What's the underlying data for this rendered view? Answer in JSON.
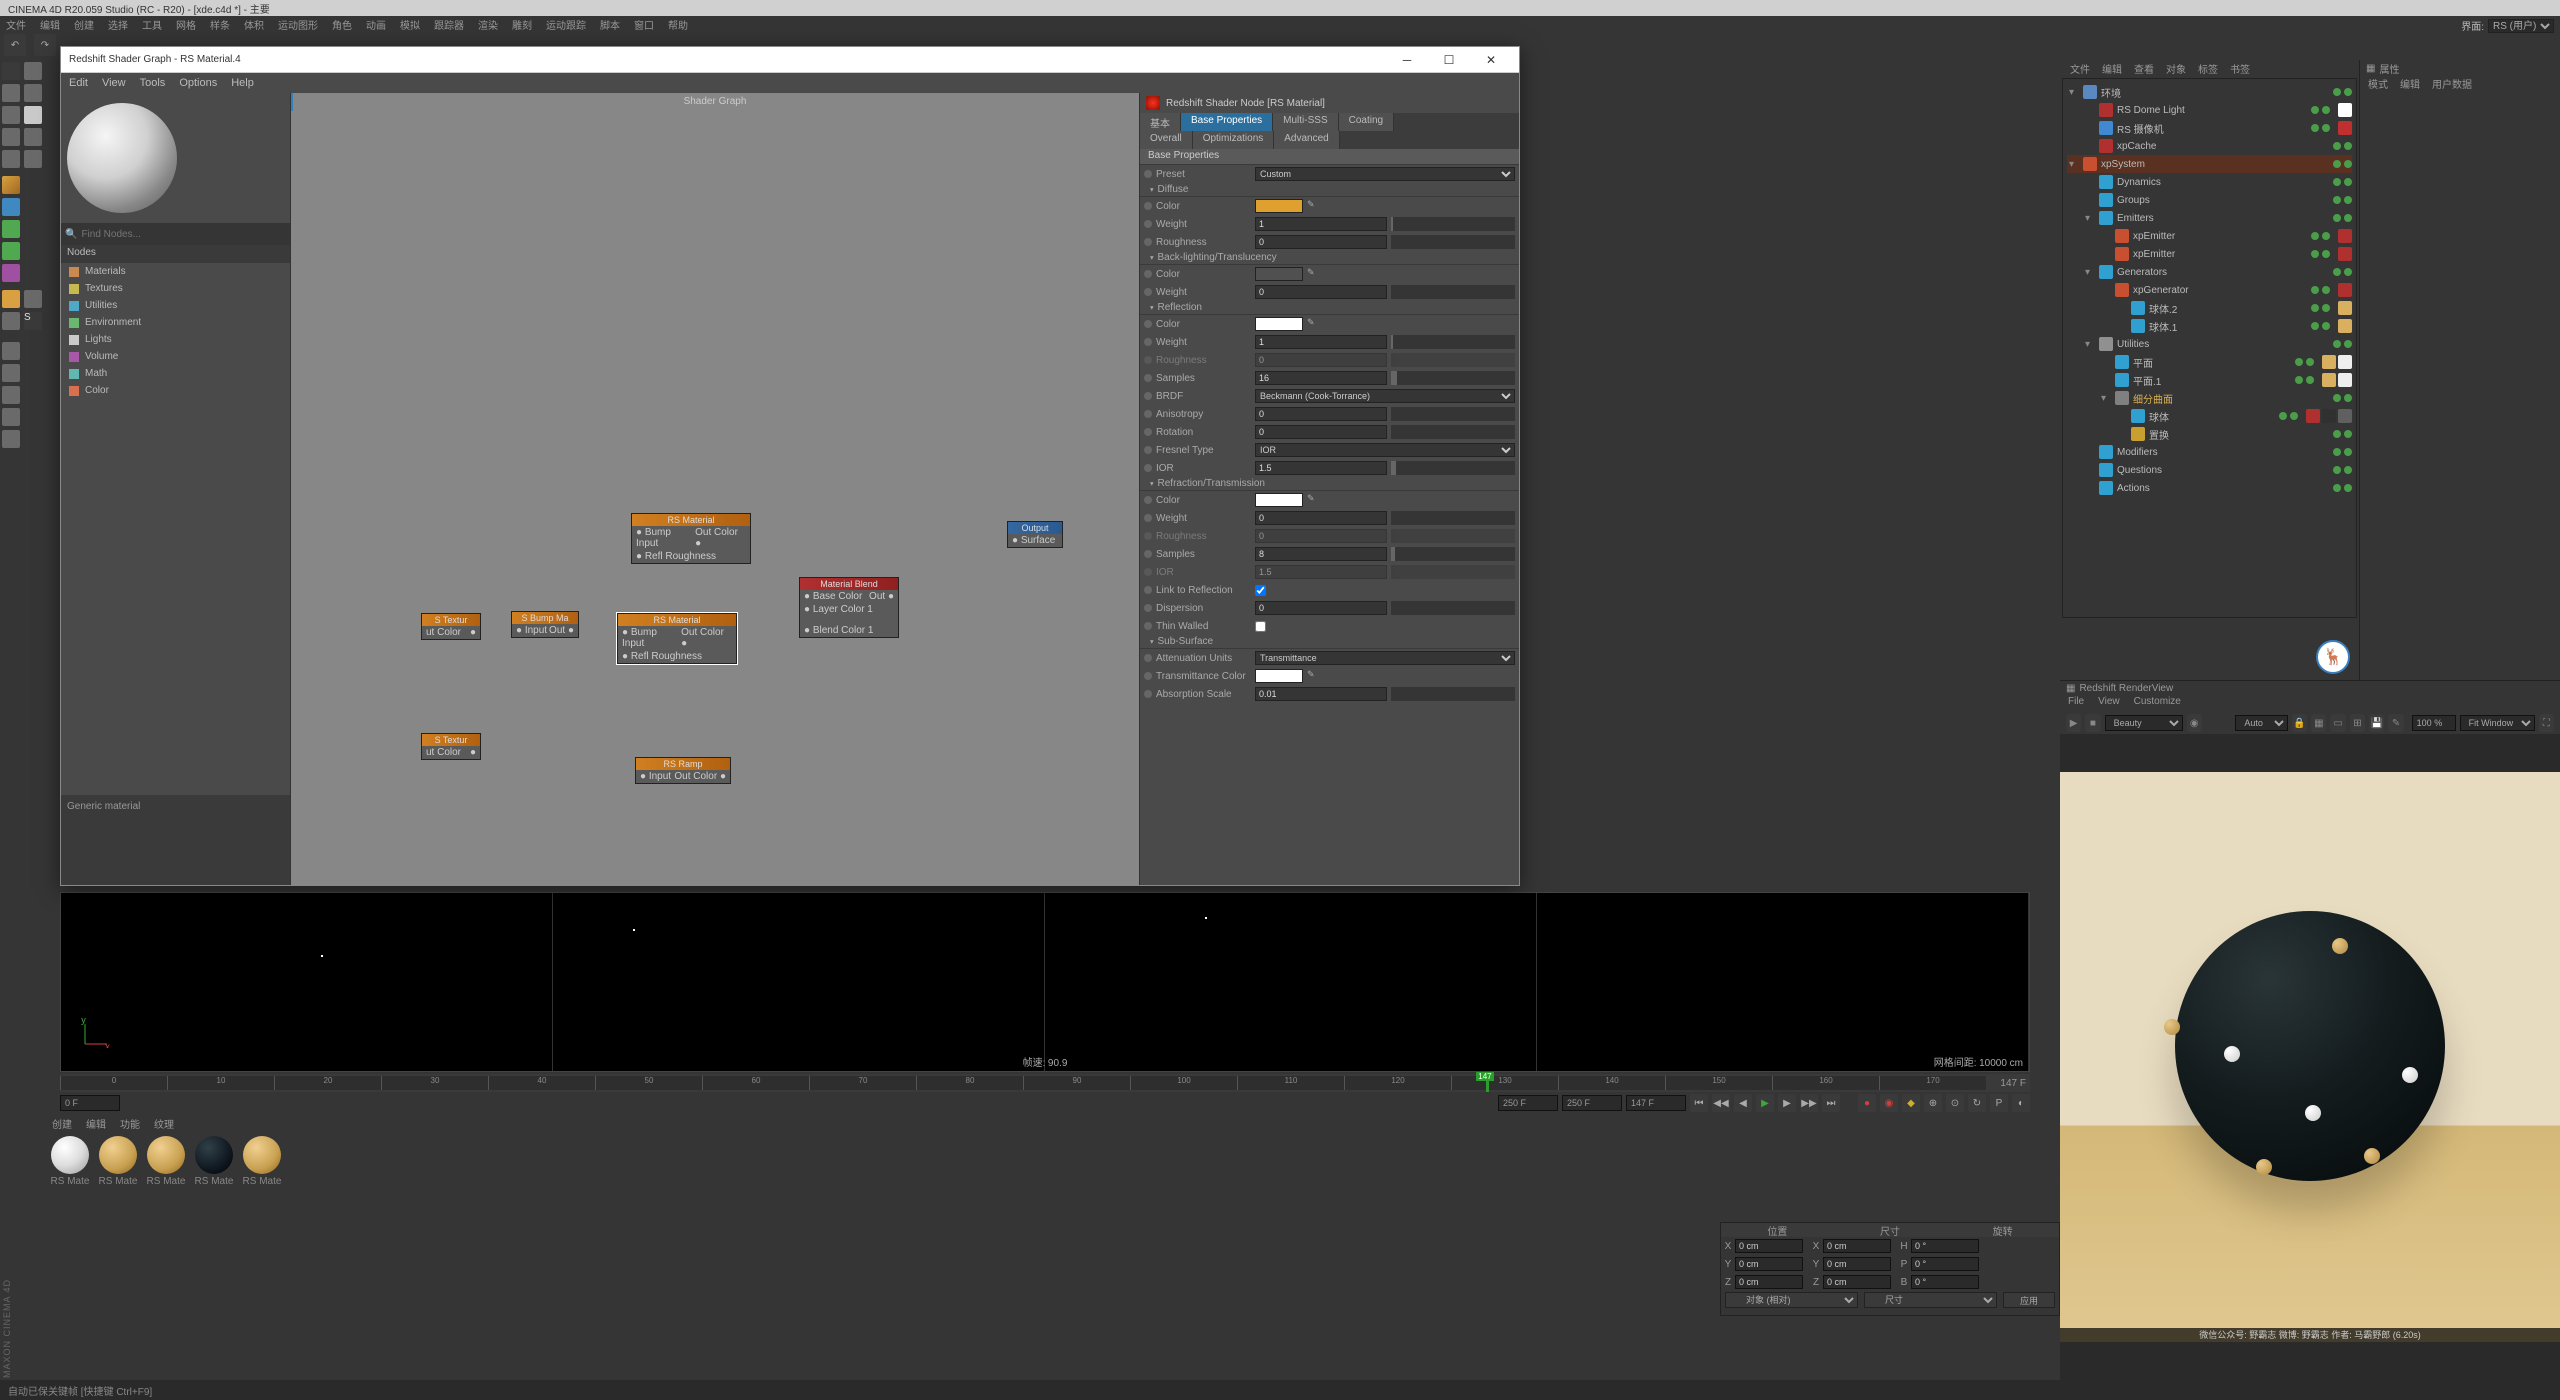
{
  "app": {
    "title": "CINEMA 4D R20.059 Studio (RC - R20) - [xde.c4d *] - 主要",
    "menus": [
      "文件",
      "编辑",
      "创建",
      "选择",
      "工具",
      "网格",
      "样条",
      "体积",
      "运动图形",
      "角色",
      "动画",
      "模拟",
      "跟踪器",
      "渲染",
      "雕刻",
      "运动跟踪",
      "脚本",
      "窗口",
      "帮助"
    ],
    "layout_label": "界面:",
    "layout_value": "RS (用户)"
  },
  "shaderWindow": {
    "title": "Redshift Shader Graph - RS Material.4",
    "menus": [
      "Edit",
      "View",
      "Tools",
      "Options",
      "Help"
    ],
    "graphTitle": "Shader Graph",
    "search_placeholder": "Find Nodes...",
    "nodesHeader": "Nodes",
    "categories": [
      {
        "label": "Materials",
        "color": "#c88a50"
      },
      {
        "label": "Textures",
        "color": "#c8b850"
      },
      {
        "label": "Utilities",
        "color": "#50a8c8"
      },
      {
        "label": "Environment",
        "color": "#6ab870"
      },
      {
        "label": "Lights",
        "color": "#cacaca"
      },
      {
        "label": "Volume",
        "color": "#a858a8"
      },
      {
        "label": "Math",
        "color": "#60b8b0"
      },
      {
        "label": "Color",
        "color": "#d87050"
      }
    ],
    "genericMaterial": "Generic material",
    "nodes": {
      "tex1": {
        "title": "S Textur",
        "port": "ut Color"
      },
      "tex2": {
        "title": "S Textur",
        "port": "ut Color"
      },
      "bump": {
        "title": "S Bump Ma",
        "in": "Input",
        "out": "Out"
      },
      "mat1": {
        "title": "RS Material",
        "p1": "Bump Input",
        "p2": "Refl Roughness",
        "out": "Out Color"
      },
      "mat2": {
        "title": "RS Material",
        "p1": "Bump Input",
        "p2": "Refl Roughness",
        "out": "Out Color"
      },
      "ramp": {
        "title": "RS Ramp",
        "in": "Input",
        "out": "Out Color"
      },
      "blend": {
        "title": "Material Blend",
        "p1": "Base Color",
        "p2": "Layer Color 1",
        "p3": "Blend Color 1",
        "out": "Out"
      },
      "output": {
        "title": "Output",
        "port": "Surface"
      }
    }
  },
  "props": {
    "header": "Redshift Shader Node [RS Material]",
    "tabs1": [
      "基本",
      "Base Properties",
      "Multi-SSS",
      "Coating"
    ],
    "tabs2": [
      "Overall",
      "Optimizations",
      "Advanced"
    ],
    "activeTab": 1,
    "baseProps": "Base Properties",
    "preset": {
      "label": "Preset",
      "value": "Custom"
    },
    "sections": {
      "diffuse": "Diffuse",
      "backlight": "Back-lighting/Translucency",
      "reflection": "Reflection",
      "refraction": "Refraction/Transmission",
      "subsurface": "Sub-Surface"
    },
    "rows": {
      "color": "Color",
      "weight": "Weight",
      "roughness": "Roughness",
      "samples": "Samples",
      "brdf": "BRDF",
      "brdf_val": "Beckmann (Cook-Torrance)",
      "anisotropy": "Anisotropy",
      "rotation": "Rotation",
      "fresnelType": "Fresnel Type",
      "fresnel_val": "IOR",
      "ior": "IOR",
      "linkRefl": "Link to Reflection",
      "dispersion": "Dispersion",
      "thinWalled": "Thin Walled",
      "attenUnits": "Attenuation Units",
      "atten_val": "Transmittance",
      "transColor": "Transmittance Color",
      "absorpScale": "Absorption Scale"
    },
    "values": {
      "diff_weight": "1",
      "diff_rough": "0",
      "back_weight": "0",
      "refl_weight": "1",
      "refl_rough": "0",
      "refl_samples": "16",
      "refl_aniso": "0",
      "refl_rot": "0",
      "refl_ior": "1.5",
      "refr_weight": "0",
      "refr_rough": "0",
      "refr_samples": "8",
      "refr_ior": "1.5",
      "dispersion": "0",
      "absorp": "0.01"
    },
    "colors": {
      "diffuse": "#e0a030",
      "back": "#505050",
      "refl": "#ffffff",
      "refr": "#ffffff",
      "trans": "#ffffff"
    }
  },
  "viewport": {
    "fps_label": "帧速:",
    "fps": "90.9",
    "grid_label": "网格间距:",
    "grid": "10000 cm"
  },
  "timeline": {
    "ticks": [
      "0",
      "10",
      "20",
      "30",
      "40",
      "50",
      "60",
      "70",
      "80",
      "90",
      "100",
      "110",
      "120",
      "130",
      "140",
      "150",
      "160",
      "170"
    ],
    "playhead_label": "147",
    "end_label": "147 F",
    "start": "0 F",
    "range_end": "250 F",
    "range_end2": "250 F",
    "max": "147 F"
  },
  "matTabs": [
    "创建",
    "编辑",
    "功能",
    "纹理"
  ],
  "materials": [
    {
      "name": "RS Mate",
      "bg": "radial-gradient(circle at 35% 30%, #fff, #ddd 50%, #999)"
    },
    {
      "name": "RS Mate",
      "bg": "radial-gradient(circle at 35% 30%, #f0d090, #c8a050 60%, #906020)"
    },
    {
      "name": "RS Mate",
      "bg": "radial-gradient(circle at 35% 30%, #f0d090, #c8a050 60%, #906020)"
    },
    {
      "name": "RS Mate",
      "bg": "radial-gradient(circle at 35% 30%, #304048, #101820 60%, #000)"
    },
    {
      "name": "RS Mate",
      "bg": "radial-gradient(circle at 35% 30%, #f0d090, #c8a050 60%, #906020)"
    }
  ],
  "coords": {
    "headers": [
      "位置",
      "尺寸",
      "旋转"
    ],
    "rows": [
      {
        "ax": "X",
        "p": "0 cm",
        "s": "0 cm",
        "r": "0 °",
        "rax": "H"
      },
      {
        "ax": "Y",
        "p": "0 cm",
        "s": "0 cm",
        "r": "0 °",
        "rax": "P"
      },
      {
        "ax": "Z",
        "p": "0 cm",
        "s": "0 cm",
        "r": "0 °",
        "rax": "B"
      }
    ],
    "modeLabel": "对象 (相对)",
    "sizeBtn": "尺寸",
    "applyBtn": "应用"
  },
  "objPanel": {
    "tabs": [
      "文件",
      "编辑",
      "查看",
      "对象",
      "标签",
      "书签"
    ],
    "tree": [
      {
        "d": 0,
        "icon": "#5a88c0",
        "name": "环境",
        "exp": true
      },
      {
        "d": 1,
        "icon": "#b03030",
        "name": "RS Dome Light",
        "tags": [
          "#ffffff"
        ]
      },
      {
        "d": 1,
        "icon": "#4088d0",
        "name": "RS 摄像机",
        "tags": [
          "#c03030"
        ]
      },
      {
        "d": 1,
        "icon": "#b03030",
        "name": "xpCache"
      },
      {
        "d": 0,
        "icon": "#c85030",
        "name": "xpSystem",
        "sel": true,
        "exp": true
      },
      {
        "d": 1,
        "icon": "#30a0d0",
        "name": "Dynamics"
      },
      {
        "d": 1,
        "icon": "#30a0d0",
        "name": "Groups"
      },
      {
        "d": 1,
        "icon": "#30a0d0",
        "name": "Emitters",
        "exp": true
      },
      {
        "d": 2,
        "icon": "#c85030",
        "name": "xpEmitter",
        "tags": [
          "#b03030"
        ]
      },
      {
        "d": 2,
        "icon": "#c85030",
        "name": "xpEmitter",
        "tags": [
          "#b03030"
        ]
      },
      {
        "d": 1,
        "icon": "#30a0d0",
        "name": "Generators",
        "exp": true
      },
      {
        "d": 2,
        "icon": "#c85030",
        "name": "xpGenerator",
        "tags": [
          "#b03030"
        ]
      },
      {
        "d": 3,
        "icon": "#30a0d0",
        "name": "球体.2",
        "tags": [
          "#d8b060"
        ]
      },
      {
        "d": 3,
        "icon": "#30a0d0",
        "name": "球体.1",
        "tags": [
          "#d8b060"
        ]
      },
      {
        "d": 1,
        "icon": "#909090",
        "name": "Utilities",
        "exp": true
      },
      {
        "d": 2,
        "icon": "#30a0d0",
        "name": "平面",
        "tags": [
          "#d8b060",
          "#eeeeee"
        ]
      },
      {
        "d": 2,
        "icon": "#30a0d0",
        "name": "平面.1",
        "tags": [
          "#d8b060",
          "#eeeeee"
        ]
      },
      {
        "d": 2,
        "icon": "#808080",
        "name": "细分曲面",
        "gold": true,
        "exp": true
      },
      {
        "d": 3,
        "icon": "#30a0d0",
        "name": "球体",
        "tags": [
          "#b03030",
          "#303030",
          "#606060"
        ]
      },
      {
        "d": 3,
        "icon": "#c8a030",
        "name": "置换"
      },
      {
        "d": 1,
        "icon": "#30a0d0",
        "name": "Modifiers"
      },
      {
        "d": 1,
        "icon": "#30a0d0",
        "name": "Questions"
      },
      {
        "d": 1,
        "icon": "#30a0d0",
        "name": "Actions"
      }
    ]
  },
  "attrib": {
    "header": "属性",
    "tabs": [
      "模式",
      "编辑",
      "用户数据"
    ]
  },
  "renderView": {
    "header": "Redshift RenderView",
    "menus": [
      "File",
      "View",
      "Customize"
    ],
    "beautyLabel": "Beauty",
    "autoLabel": "Auto",
    "zoom": "100 %",
    "fitLabel": "Fit Window",
    "caption": "微信公众号: 野霸志   微博: 野霸志  作者: 马霸野郎  (6.20s)"
  },
  "status": "自动已保关键帧 [快捷键 Ctrl+F9]"
}
